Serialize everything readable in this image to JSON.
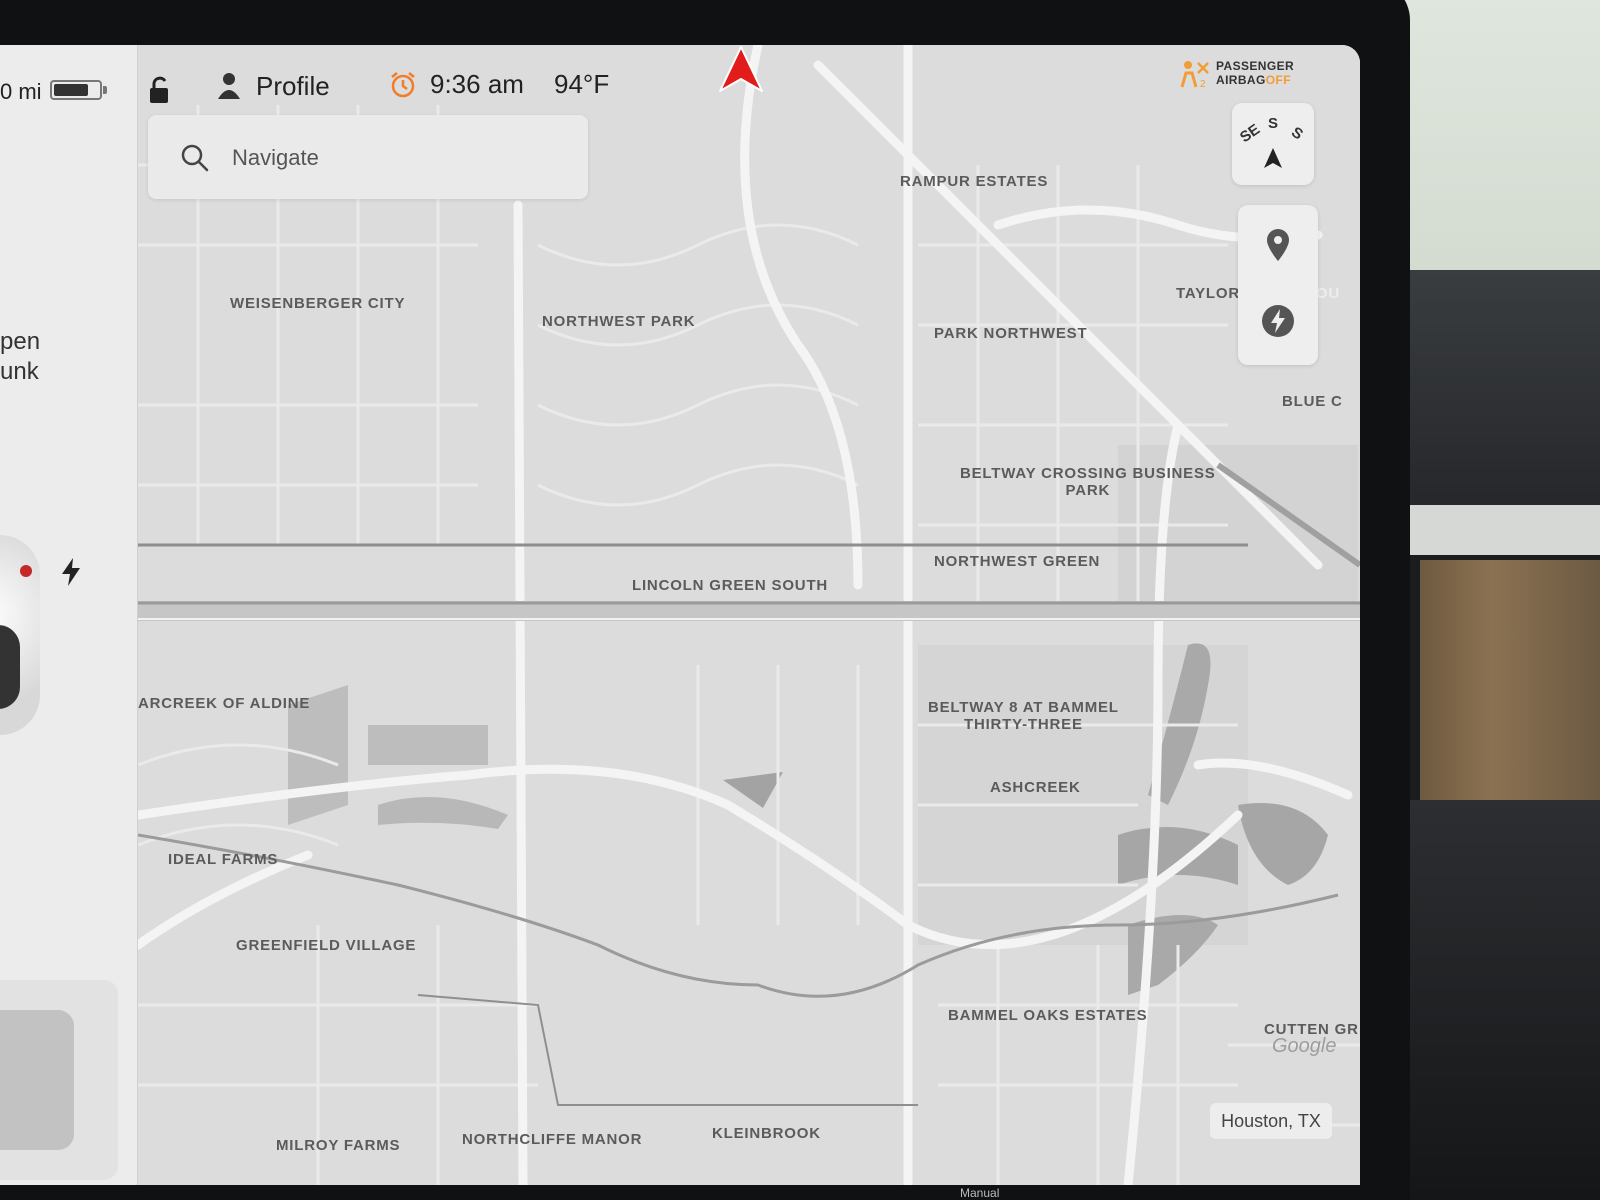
{
  "status": {
    "range": "0 mi",
    "battery_level": 0.78,
    "profile_label": "Profile",
    "time": "9:36 am",
    "temperature": "94°F",
    "airbag_line1": "PASSENGER",
    "airbag_line2": "AIRBAG",
    "airbag_state": "OFF"
  },
  "car_panel": {
    "trunk_line1": "pen",
    "trunk_line2": "unk"
  },
  "search": {
    "placeholder": "Navigate"
  },
  "compass": {
    "heading": "S",
    "left": "SE",
    "right": "S"
  },
  "map": {
    "labels": {
      "rampur_estates": "RAMPUR ESTATES",
      "weisenberger_city": "WEISENBERGER CITY",
      "northwest_park": "NORTHWEST PARK",
      "taylor": "TAYLOR",
      "north_hou": "NORTH HOU",
      "park_northwest": "PARK NORTHWEST",
      "blue_c": "BLUE C",
      "beltway_crossing_1": "BELTWAY CROSSING BUSINESS",
      "beltway_crossing_2": "PARK",
      "northwest_green": "NORTHWEST GREEN",
      "lincoln_green_south": "LINCOLN GREEN SOUTH",
      "arcreek_aldine": "ARCREEK OF ALDINE",
      "beltway8_1": "BELTWAY 8 AT BAMMEL",
      "beltway8_2": "THIRTY-THREE",
      "ashcreek": "ASHCREEK",
      "ideal_farms": "IDEAL FARMS",
      "greenfield_village": "GREENFIELD VILLAGE",
      "bammel_oaks": "BAMMEL OAKS ESTATES",
      "cutten_gr": "CUTTEN GR",
      "milroy_farms": "MILROY FARMS",
      "northcliffe_manor": "NORTHCLIFFE MANOR",
      "kleinbrook": "KLEINBROOK"
    },
    "attribution": "Google",
    "location": "Houston, TX"
  },
  "colors": {
    "nav_arrow": "#e21b1b",
    "airbag_off": "#f29c38",
    "alarm": "#f07d2a"
  },
  "footer": {
    "manual": "Manual"
  }
}
